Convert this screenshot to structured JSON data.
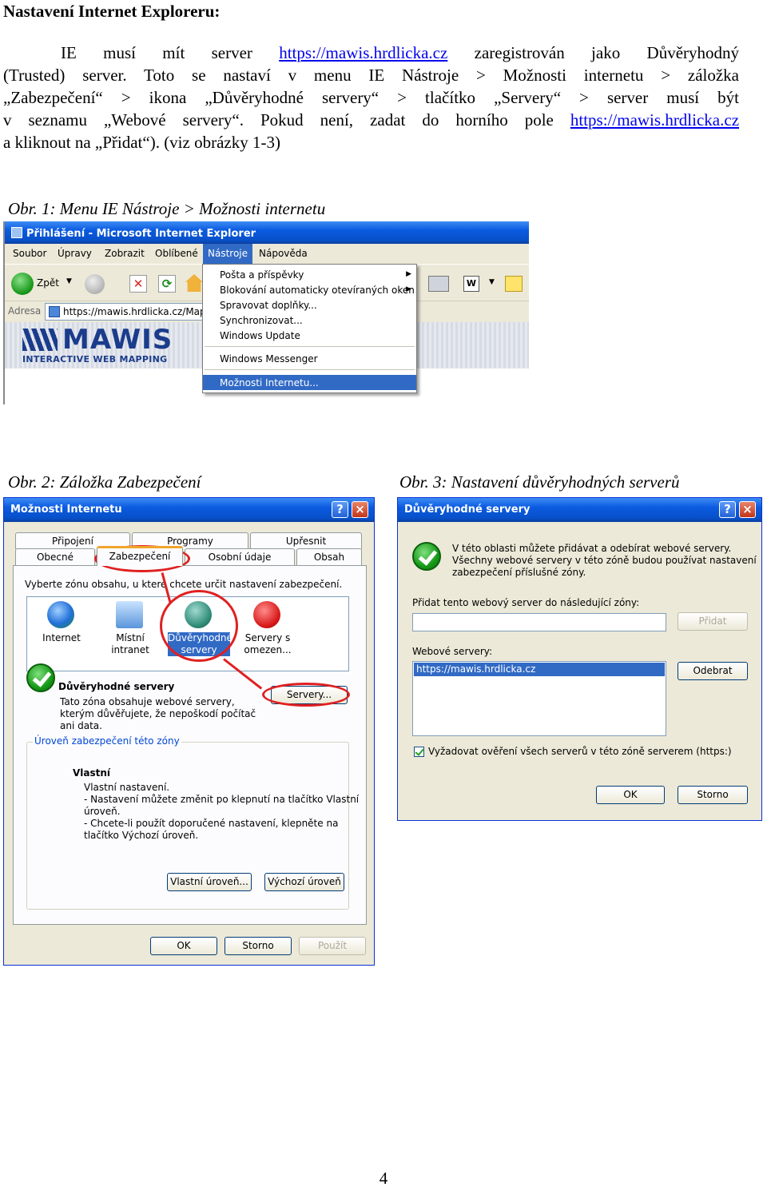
{
  "document": {
    "title": "Nastavení Internet Exploreru:",
    "paragraph": {
      "l1_a": "IE musí mít server",
      "link": "https://mawis.hrdlicka.cz",
      "l1_b": "zaregistrován jako Důvěryhodný",
      "l2": "(Trusted) server. Toto se nastaví v menu IE Nástroje > Možnosti internetu > záložka",
      "l3": "„Zabezpečení“ > ikona „Důvěryhodné servery“ > tlačítko „Servery“ > server musí být",
      "l4_a": "v seznamu „Webové servery“. Pokud není, zadat do horního pole",
      "l5": "a kliknout na „Přidat“). (viz obrázky 1-3)"
    },
    "captions": {
      "fig1": "Obr. 1: Menu IE Nástroje > Možnosti internetu",
      "fig2": "Obr. 2: Záložka Zabezpečení",
      "fig3": "Obr. 3: Nastavení důvěryhodných serverů"
    },
    "page_number": "4"
  },
  "fig1": {
    "title": "Přihlášení - Microsoft Internet Explorer",
    "menu": [
      "Soubor",
      "Úpravy",
      "Zobrazit",
      "Oblíbené",
      "Nástroje",
      "Nápověda"
    ],
    "back_label": "Zpět",
    "address_label": "Adresa",
    "address_value": "https://mawis.hrdlicka.cz/MapS",
    "logo": "MAWIS",
    "logo_sub": "INTERACTIVE WEB MAPPING",
    "dropdown": [
      "Pošta a příspěvky",
      "Blokování automaticky otevíraných oken",
      "Spravovat doplňky...",
      "Synchronizovat...",
      "Windows Update",
      "Windows Messenger",
      "Možnosti Internetu..."
    ]
  },
  "fig2": {
    "title": "Možnosti Internetu",
    "tabs_back": [
      "Připojení",
      "Programy",
      "Upřesnit"
    ],
    "tabs_front": [
      "Obecné",
      "Zabezpečení",
      "Osobní údaje",
      "Obsah"
    ],
    "zone_prompt": "Vyberte zónu obsahu, u které chcete určit nastavení zabezpečení.",
    "zones": [
      "Internet",
      "Místní intranet",
      "Důvěryhodné servery",
      "Servery s omezen..."
    ],
    "zone_heading": "Důvěryhodné servery",
    "zone_desc": [
      "Tato zóna obsahuje webové servery,",
      "kterým důvěřujete, že nepoškodí počítač",
      "ani data."
    ],
    "servers_button": "Servery...",
    "level_legend": "Úroveň zabezpečení této zóny",
    "level_title": "Vlastní",
    "level_lines": [
      "Vlastní nastavení.",
      "- Nastavení můžete změnit po klepnutí na tlačítko Vlastní",
      "úroveň.",
      "- Chcete-li použít doporučené nastavení, klepněte na",
      "tlačítko Výchozí úroveň."
    ],
    "btn_custom": "Vlastní úroveň...",
    "btn_default": "Výchozí úroveň",
    "btn_ok": "OK",
    "btn_cancel": "Storno",
    "btn_apply": "Použít"
  },
  "fig3": {
    "title": "Důvěryhodné servery",
    "info": [
      "V této oblasti můžete přidávat a odebírat webové servery.",
      "Všechny webové servery v této zóně budou používat nastavení",
      "zabezpečení příslušné zóny."
    ],
    "add_label": "Přidat tento webový server do následující zóny:",
    "add_value": "",
    "btn_add": "Přidat",
    "list_label": "Webové servery:",
    "list_items": [
      "https://mawis.hrdlicka.cz"
    ],
    "btn_remove": "Odebrat",
    "verify_label": "Vyžadovat ověření všech serverů v této zóně serverem (https:)",
    "verify_checked": true,
    "btn_ok": "OK",
    "btn_cancel": "Storno"
  }
}
